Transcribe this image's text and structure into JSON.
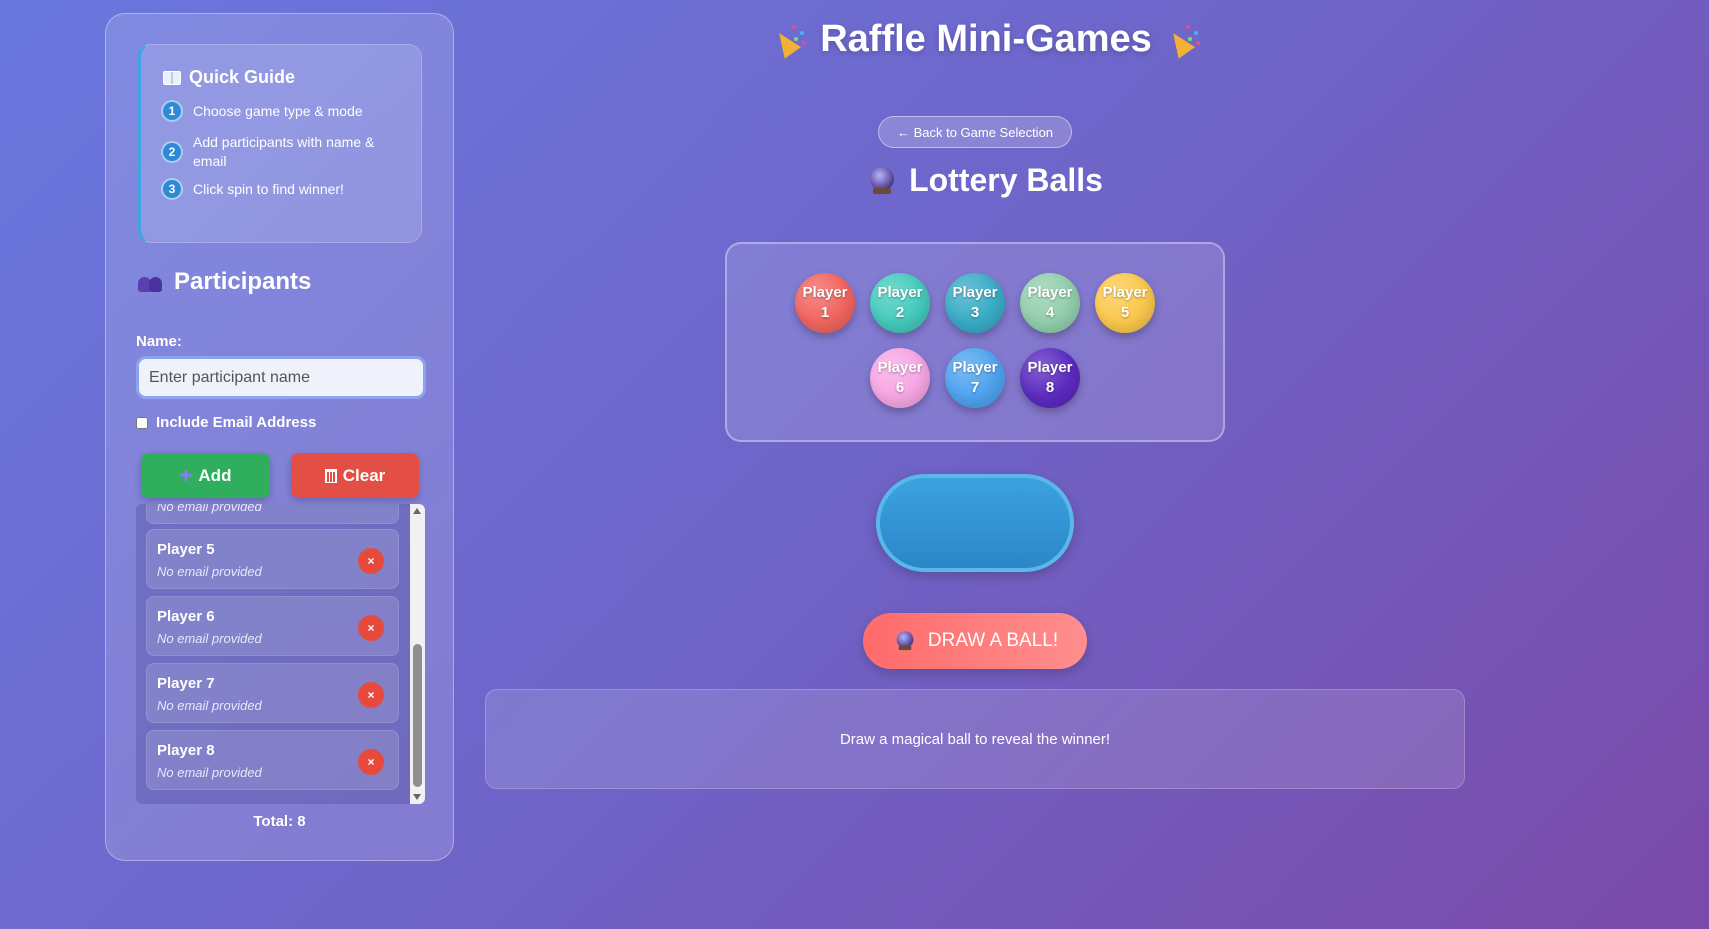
{
  "app": {
    "title": "Raffle Mini-Games"
  },
  "guide": {
    "title": "Quick Guide",
    "steps": [
      {
        "num": "1",
        "text": "Choose game type & mode"
      },
      {
        "num": "2",
        "text": "Add participants with name & email"
      },
      {
        "num": "3",
        "text": "Click spin to find winner!"
      }
    ]
  },
  "participants": {
    "title": "Participants",
    "name_label": "Name:",
    "name_placeholder": "Enter participant name",
    "email_toggle_label": "Include Email Address",
    "add_label": "Add",
    "clear_label": "Clear",
    "partial_email": "No email provided",
    "list": [
      {
        "name": "Player 5",
        "email": "No email provided",
        "remove": "×"
      },
      {
        "name": "Player 6",
        "email": "No email provided",
        "remove": "×"
      },
      {
        "name": "Player 7",
        "email": "No email provided",
        "remove": "×"
      },
      {
        "name": "Player 8",
        "email": "No email provided",
        "remove": "×"
      }
    ],
    "total": "Total: 8"
  },
  "game": {
    "back_label": "← Back to Game Selection",
    "title": "Lottery Balls",
    "balls": [
      {
        "line1": "Player",
        "line2": "1",
        "color": "#f2655f"
      },
      {
        "line1": "Player",
        "line2": "2",
        "color": "#45cbbd"
      },
      {
        "line1": "Player",
        "line2": "3",
        "color": "#3aacc6"
      },
      {
        "line1": "Player",
        "line2": "4",
        "color": "#93cfad"
      },
      {
        "line1": "Player",
        "line2": "5",
        "color": "#fbc84c"
      },
      {
        "line1": "Player",
        "line2": "6",
        "color": "#f7a6e4"
      },
      {
        "line1": "Player",
        "line2": "7",
        "color": "#4fa3ef"
      },
      {
        "line1": "Player",
        "line2": "8",
        "color": "#5b2bc1"
      }
    ],
    "draw_label": "DRAW A BALL!",
    "result_text": "Draw a magical ball to reveal the winner!"
  }
}
